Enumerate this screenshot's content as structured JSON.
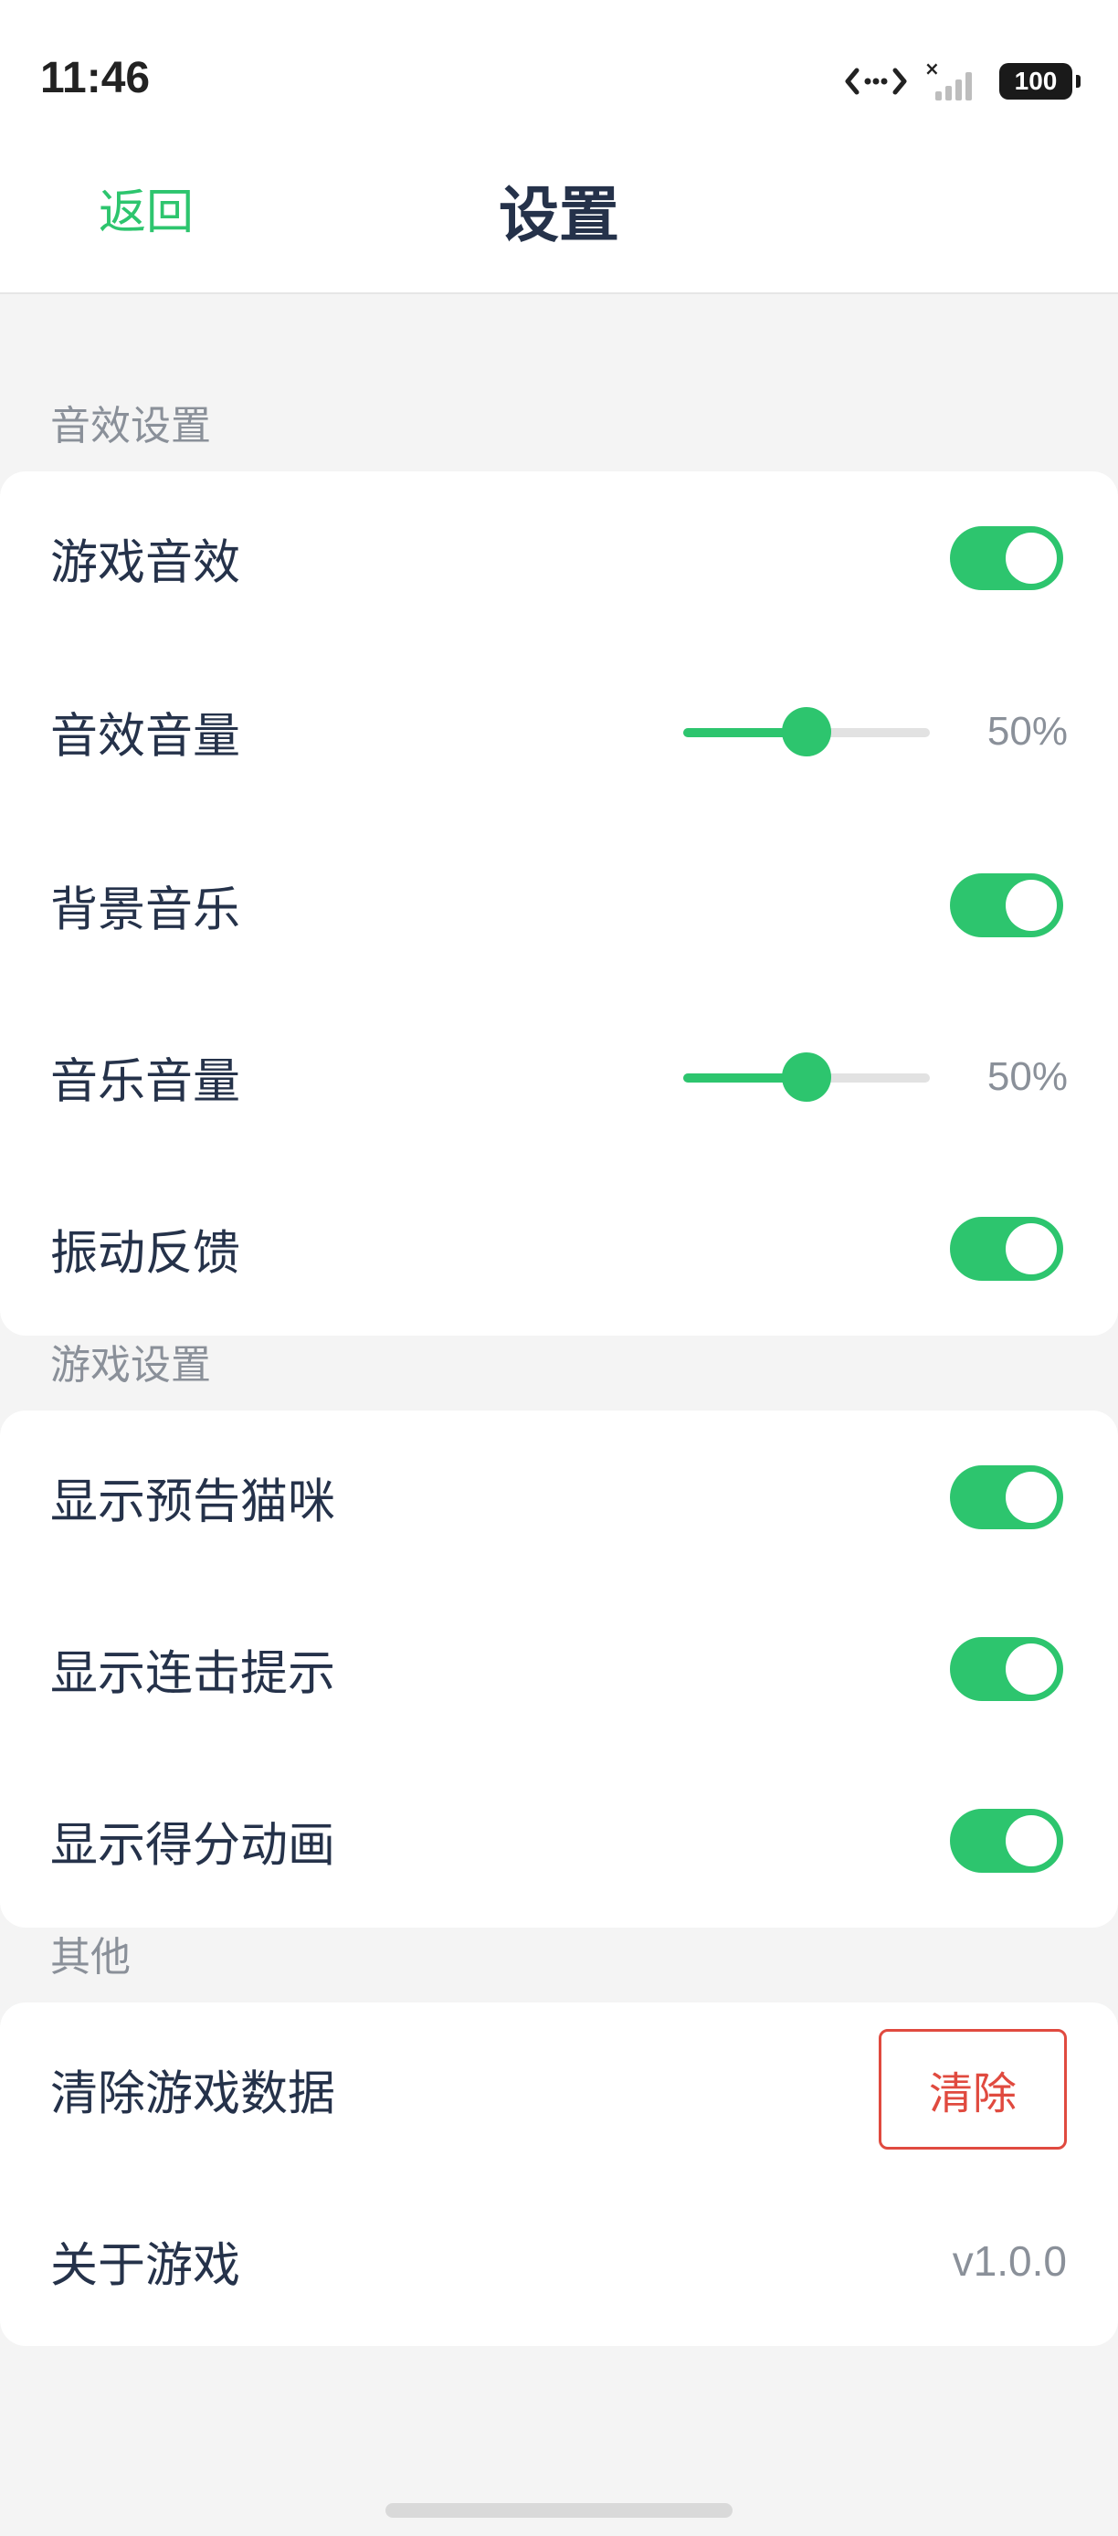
{
  "status_bar": {
    "time": "11:46",
    "battery": "100"
  },
  "nav": {
    "back_label": "返回",
    "title": "设置"
  },
  "sections": {
    "sound": {
      "label": "音效设置",
      "game_sfx": {
        "label": "游戏音效",
        "enabled": true
      },
      "sfx_volume": {
        "label": "音效音量",
        "value": 50,
        "display": "50%"
      },
      "bg_music": {
        "label": "背景音乐",
        "enabled": true
      },
      "music_volume": {
        "label": "音乐音量",
        "value": 50,
        "display": "50%"
      },
      "vibration": {
        "label": "振动反馈",
        "enabled": true
      }
    },
    "game": {
      "label": "游戏设置",
      "show_preview_cat": {
        "label": "显示预告猫咪",
        "enabled": true
      },
      "show_combo_hint": {
        "label": "显示连击提示",
        "enabled": true
      },
      "show_score_anim": {
        "label": "显示得分动画",
        "enabled": true
      }
    },
    "other": {
      "label": "其他",
      "clear_data": {
        "label": "清除游戏数据",
        "button": "清除"
      },
      "about": {
        "label": "关于游戏",
        "version": "v1.0.0"
      }
    }
  },
  "colors": {
    "accent": "#2dc56e",
    "danger": "#e04a3f",
    "text": "#25324a",
    "muted": "#8a9099"
  }
}
